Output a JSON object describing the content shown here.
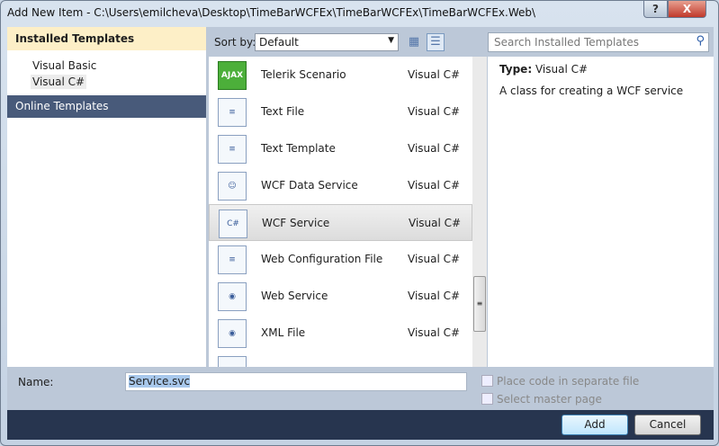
{
  "window": {
    "title": "Add New Item - C:\\Users\\emilcheva\\Desktop\\TimeBarWCFEx\\TimeBarWCFEx\\TimeBarWCFEx.Web\\",
    "help": "?",
    "close": "X"
  },
  "left": {
    "header": "Installed Templates",
    "items": [
      {
        "label": "Visual Basic"
      },
      {
        "label": "Visual C#"
      }
    ],
    "online": "Online Templates"
  },
  "toolbar": {
    "sort_label": "Sort by:",
    "sort_value": "Default",
    "search_placeholder": "Search Installed Templates"
  },
  "templates": [
    {
      "name": "Telerik Scenario",
      "lang": "Visual C#",
      "icon": "AJAX"
    },
    {
      "name": "Text File",
      "lang": "Visual C#",
      "icon": "≡"
    },
    {
      "name": "Text Template",
      "lang": "Visual C#",
      "icon": "≡"
    },
    {
      "name": "WCF Data Service",
      "lang": "Visual C#",
      "icon": "☺"
    },
    {
      "name": "WCF Service",
      "lang": "Visual C#",
      "icon": "C#"
    },
    {
      "name": "Web Configuration File",
      "lang": "Visual C#",
      "icon": "≡"
    },
    {
      "name": "Web Service",
      "lang": "Visual C#",
      "icon": "◉"
    },
    {
      "name": "XML File",
      "lang": "Visual C#",
      "icon": "◉"
    },
    {
      "name": "",
      "lang": "",
      "icon": "<>"
    }
  ],
  "details": {
    "type_label": "Type:",
    "type_value": "Visual C#",
    "description": "A class for creating a WCF service"
  },
  "form": {
    "name_label": "Name:",
    "name_value": "Service.svc",
    "separate_file": "Place code in separate file",
    "master_page": "Select master page"
  },
  "buttons": {
    "add": "Add",
    "cancel": "Cancel"
  }
}
